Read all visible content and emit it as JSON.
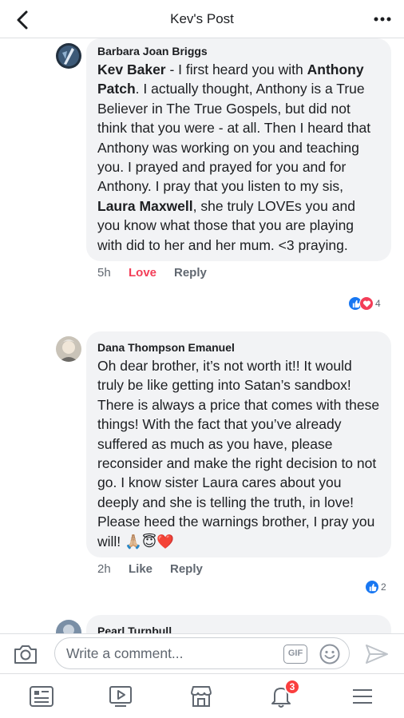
{
  "header": {
    "title": "Kev's Post"
  },
  "comments": [
    {
      "author": "Barbara Joan Briggs",
      "segments": [
        {
          "text": "Kev Baker",
          "bold": true
        },
        {
          "text": " - I first heard you with "
        },
        {
          "text": "Anthony Patch",
          "bold": true
        },
        {
          "text": ".  I actually thought, Anthony is a True Believer in The True Gospels, but did not think that you were - at all.  Then I heard that Anthony was working on you and teaching you.  I prayed and prayed for you and for Anthony.  I pray that you listen to my sis, "
        },
        {
          "text": "Laura Maxwell",
          "bold": true
        },
        {
          "text": ", she truly LOVEs you and you know what those that you are playing with did to her and her mum. <3 praying."
        }
      ],
      "time": "5h",
      "reaction_label": "Love",
      "reply_label": "Reply",
      "reaction_count": "4"
    },
    {
      "author": "Dana Thompson Emanuel",
      "text": "Oh dear brother, it’s not worth it!! It would truly be like getting into Satan’s sandbox! There is always a price that comes with these things! With the fact that you’ve already suffered as much as you have, please reconsider and make the right decision to not go. I know sister Laura cares about you deeply and she is telling the truth, in love! Please heed the warnings brother, I pray you will! 🙏🏼😇❤️",
      "time": "2h",
      "like_label": "Like",
      "reply_label": "Reply",
      "reaction_count": "2"
    },
    {
      "author": "Pearl Turnbull"
    }
  ],
  "composer": {
    "placeholder": "Write a comment...",
    "gif_label": "GIF"
  },
  "tabbar": {
    "notification_count": "3"
  },
  "colors": {
    "accent": "#1877f2",
    "love": "#f33e58",
    "bubble": "#f2f3f5",
    "badge": "#fa3e3e"
  }
}
